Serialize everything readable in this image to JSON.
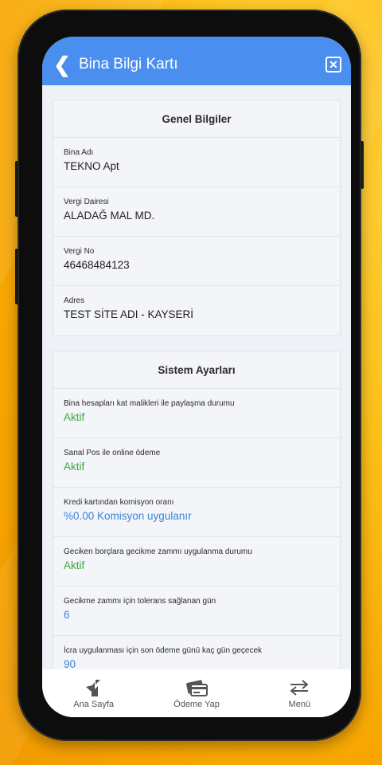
{
  "header": {
    "title": "Bina Bilgi Kartı",
    "back_icon": "chevron-left-icon",
    "close_icon": "close-icon"
  },
  "general": {
    "title": "Genel Bilgiler",
    "rows": [
      {
        "label": "Bina Adı",
        "value": "TEKNO Apt"
      },
      {
        "label": "Vergi Dairesi",
        "value": "ALADAĞ MAL MD."
      },
      {
        "label": "Vergi No",
        "value": "46468484123"
      },
      {
        "label": "Adres",
        "value": "TEST SİTE ADI - KAYSERİ"
      }
    ]
  },
  "system": {
    "title": "Sistem Ayarları",
    "rows": [
      {
        "label": "Bina hesapları kat malikleri ile paylaşma durumu",
        "value": "Aktif"
      },
      {
        "label": "Sanal Pos ile online ödeme",
        "value": "Aktif"
      },
      {
        "label": "Kredi kartından komisyon oranı",
        "value": "%0.00 Komisyon uygulanır"
      },
      {
        "label": "Geciken borçlara gecikme zammı uygulanma durumu",
        "value": "Aktif"
      },
      {
        "label": "Gecikme zammı için tolerans sağlanan gün",
        "value": "6"
      },
      {
        "label": "İcra uygulanması için son ödeme günü kaç gün geçecek",
        "value": "90"
      }
    ]
  },
  "tabbar": {
    "items": [
      {
        "label": "Ana Sayfa",
        "icon": "home-icon"
      },
      {
        "label": "Ödeme Yap",
        "icon": "payment-card-icon"
      },
      {
        "label": "Menü",
        "icon": "swap-arrows-icon"
      }
    ]
  },
  "colors": {
    "header": "#4a8ef0",
    "active_green": "#3aa83a",
    "value_blue": "#3c82d8"
  }
}
